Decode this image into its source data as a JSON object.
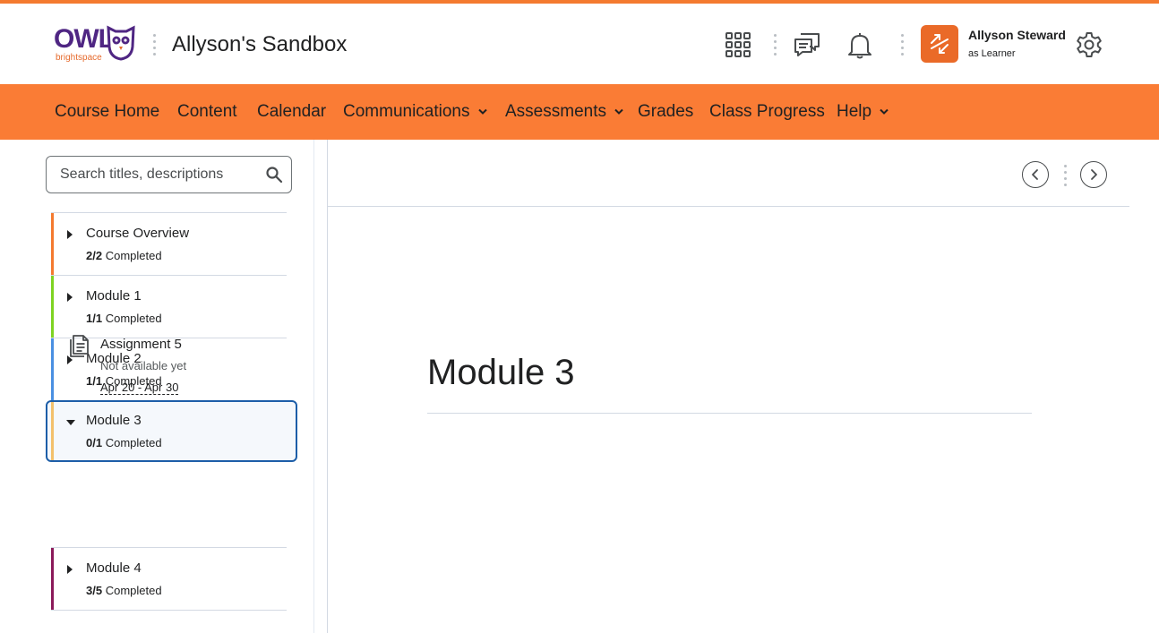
{
  "colors": {
    "accent": "#fa7c35",
    "brand_purple": "#4f2683",
    "selection_border": "#1d5ea8"
  },
  "brand": {
    "logo_main": "OWL",
    "logo_sub": "brightspace"
  },
  "header": {
    "course_title": "Allyson's Sandbox",
    "icons": [
      "waffle-icon",
      "chat-icon",
      "bell-icon",
      "role-switch-icon",
      "gear-icon"
    ],
    "user": {
      "name": "Allyson Steward",
      "role": "as Learner"
    }
  },
  "nav": {
    "items": [
      {
        "label": "Course Home",
        "dropdown": false
      },
      {
        "label": "Content",
        "dropdown": false
      },
      {
        "label": "Calendar",
        "dropdown": false
      },
      {
        "label": "Communications",
        "dropdown": true
      },
      {
        "label": "Assessments",
        "dropdown": true
      },
      {
        "label": "Grades",
        "dropdown": false
      },
      {
        "label": "Class Progress",
        "dropdown": false
      },
      {
        "label": "Help",
        "dropdown": true
      }
    ]
  },
  "sidebar": {
    "search_placeholder": "Search titles, descriptions",
    "toc": [
      {
        "title": "Course Overview",
        "progress": "2/2",
        "progress_suffix": "Completed",
        "color": "#f47a2f",
        "expanded": false
      },
      {
        "title": "Module 1",
        "progress": "1/1",
        "progress_suffix": "Completed",
        "color": "#7ed321",
        "expanded": false
      },
      {
        "title": "Module 2",
        "progress": "1/1",
        "progress_suffix": "Completed",
        "color": "#4a90e2",
        "expanded": false
      },
      {
        "title": "Module 3",
        "progress": "0/1",
        "progress_suffix": "Completed",
        "color": "#f3c06b",
        "expanded": true,
        "selected": true
      },
      {
        "title": "Module 4",
        "progress": "3/5",
        "progress_suffix": "Completed",
        "color": "#8b1a5a",
        "expanded": false
      }
    ],
    "topic": {
      "title": "Assignment 5",
      "status": "Not available yet",
      "dates": "Apr 20 - Apr 30"
    }
  },
  "main": {
    "title": "Module 3"
  }
}
